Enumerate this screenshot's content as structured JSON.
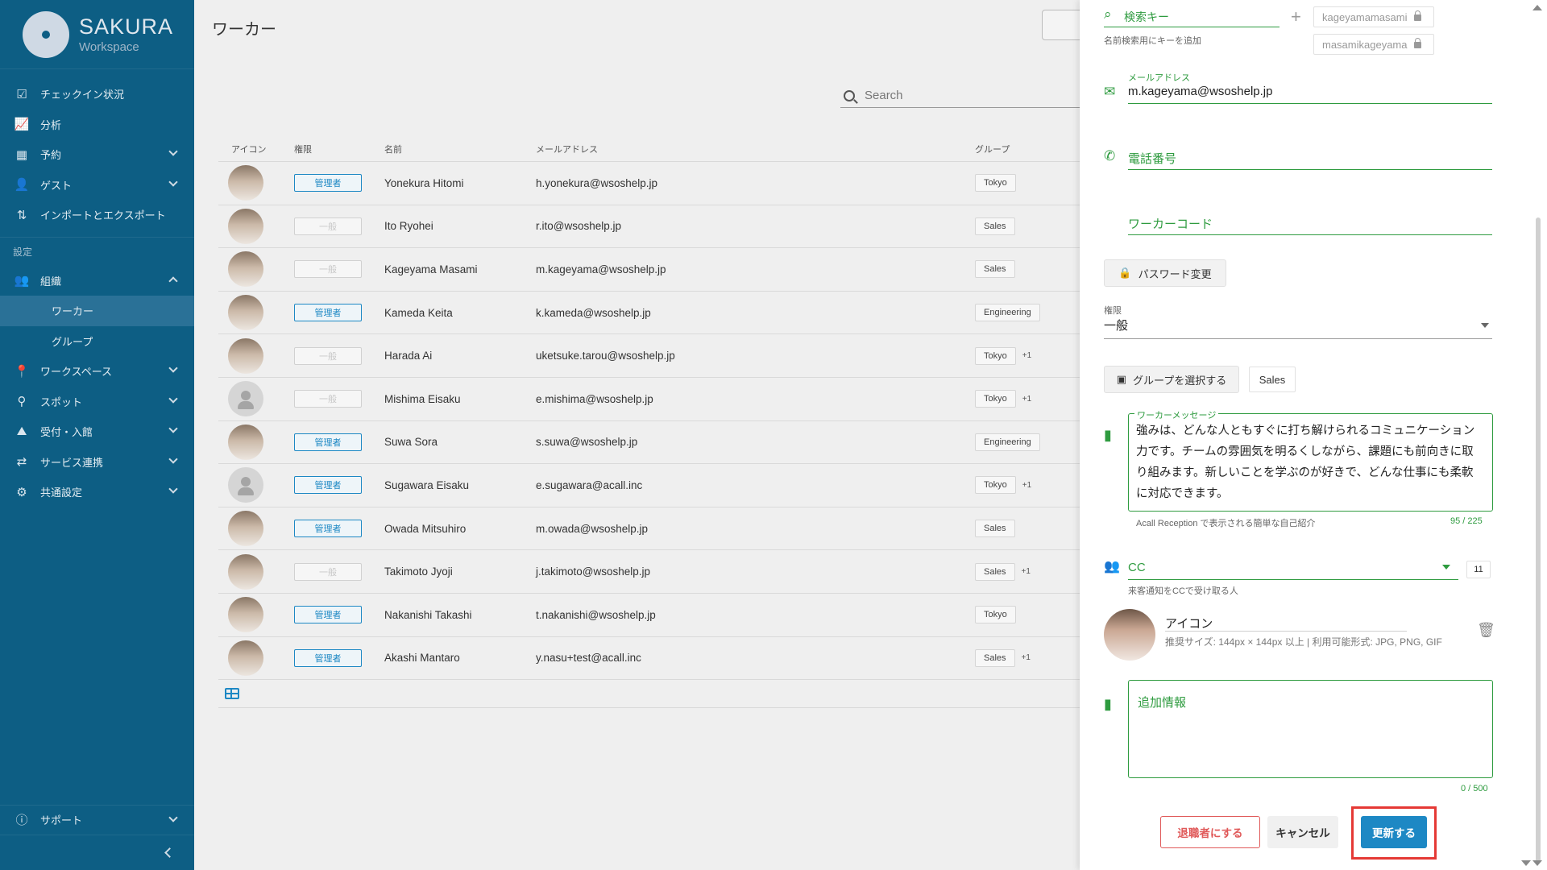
{
  "sidebar": {
    "brand": {
      "name": "SAKURA",
      "sub": "Workspace"
    },
    "items": [
      {
        "label": "チェックイン状況",
        "icon": "checkbox-icon"
      },
      {
        "label": "分析",
        "icon": "chart-icon"
      },
      {
        "label": "予約",
        "icon": "calendar-icon"
      },
      {
        "label": "ゲスト",
        "icon": "guest-icon"
      },
      {
        "label": "インポートとエクスポート",
        "icon": "import-export-icon"
      }
    ],
    "section_label": "設定",
    "org": {
      "label": "組織",
      "sub": [
        "ワーカー",
        "グループ"
      ]
    },
    "more": [
      {
        "label": "ワークスペース"
      },
      {
        "label": "スポット"
      },
      {
        "label": "受付・入館"
      },
      {
        "label": "サービス連携"
      },
      {
        "label": "共通設定"
      }
    ],
    "support": "サポート"
  },
  "main": {
    "title": "ワーカー",
    "search_placeholder": "Search",
    "headers": {
      "icon": "アイコン",
      "role": "権限",
      "name": "名前",
      "email": "メールアドレス",
      "group": "グループ"
    },
    "rows": [
      {
        "role": "管理者",
        "admin": true,
        "name": "Yonekura Hitomi",
        "email": "h.yonekura@wsoshelp.jp",
        "group": "Tokyo",
        "more": "",
        "photo": true
      },
      {
        "role": "一般",
        "admin": false,
        "name": "Ito Ryohei",
        "email": "r.ito@wsoshelp.jp",
        "group": "Sales",
        "more": "",
        "photo": true
      },
      {
        "role": "一般",
        "admin": false,
        "name": "Kageyama Masami",
        "email": "m.kageyama@wsoshelp.jp",
        "group": "Sales",
        "more": "",
        "photo": true
      },
      {
        "role": "管理者",
        "admin": true,
        "name": "Kameda Keita",
        "email": "k.kameda@wsoshelp.jp",
        "group": "Engineering",
        "more": "",
        "photo": true
      },
      {
        "role": "一般",
        "admin": false,
        "name": "Harada Ai",
        "email": "uketsuke.tarou@wsoshelp.jp",
        "group": "Tokyo",
        "more": "+1",
        "photo": true
      },
      {
        "role": "一般",
        "admin": false,
        "name": "Mishima Eisaku",
        "email": "e.mishima@wsoshelp.jp",
        "group": "Tokyo",
        "more": "+1",
        "photo": false
      },
      {
        "role": "管理者",
        "admin": true,
        "name": "Suwa Sora",
        "email": "s.suwa@wsoshelp.jp",
        "group": "Engineering",
        "more": "",
        "photo": true
      },
      {
        "role": "管理者",
        "admin": true,
        "name": "Sugawara Eisaku",
        "email": "e.sugawara@acall.inc",
        "group": "Tokyo",
        "more": "+1",
        "photo": false
      },
      {
        "role": "管理者",
        "admin": true,
        "name": "Owada Mitsuhiro",
        "email": "m.owada@wsoshelp.jp",
        "group": "Sales",
        "more": "",
        "photo": true
      },
      {
        "role": "一般",
        "admin": false,
        "name": "Takimoto Jyoji",
        "email": "j.takimoto@wsoshelp.jp",
        "group": "Sales",
        "more": "+1",
        "photo": true
      },
      {
        "role": "管理者",
        "admin": true,
        "name": "Nakanishi Takashi",
        "email": "t.nakanishi@wsoshelp.jp",
        "group": "Tokyo",
        "more": "",
        "photo": true
      },
      {
        "role": "管理者",
        "admin": true,
        "name": "Akashi Mantaro",
        "email": "y.nasu+test@acall.inc",
        "group": "Sales",
        "more": "+1",
        "photo": true
      }
    ]
  },
  "drawer": {
    "search_key": {
      "label": "検索キー",
      "helper": "名前検索用にキーを追加",
      "keys": [
        "kageyamamasami",
        "masamikageyama"
      ]
    },
    "email": {
      "label": "メールアドレス",
      "value": "m.kageyama@wsoshelp.jp"
    },
    "phone": {
      "label": "電話番号"
    },
    "worker_code": {
      "label": "ワーカーコード"
    },
    "password_button": "パスワード変更",
    "role": {
      "label": "権限",
      "value": "一般"
    },
    "group": {
      "button": "グループを選択する",
      "chip": "Sales"
    },
    "message": {
      "label": "ワーカーメッセージ",
      "text": "強みは、どんな人ともすぐに打ち解けられるコミュニケーション力です。チームの雰囲気を明るくしながら、課題にも前向きに取り組みます。新しいことを学ぶのが好きで、どんな仕事にも柔軟に対応できます。",
      "helper": "Acall Reception で表示される簡単な自己紹介",
      "counter": "95 / 225"
    },
    "cc": {
      "label": "CC",
      "count": "11",
      "helper": "来客通知をCCで受け取る人"
    },
    "icon": {
      "label": "アイコン",
      "hint": "推奨サイズ: 144px × 144px 以上 | 利用可能形式: JPG, PNG, GIF"
    },
    "additional": {
      "placeholder": "追加情報",
      "counter": "0 / 500"
    },
    "buttons": {
      "retire": "退職者にする",
      "cancel": "キャンセル",
      "update": "更新する"
    }
  },
  "colors": {
    "sidebar": "#0d5e84",
    "accent_green": "#2e9b3f",
    "primary_blue": "#1d88c4",
    "danger": "#e05a5a",
    "highlight": "#e53935"
  }
}
